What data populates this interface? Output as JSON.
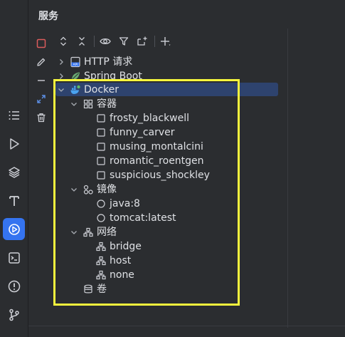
{
  "panel": {
    "title": "服务"
  },
  "tree": {
    "http": "HTTP 请求",
    "spring": "Spring Boot",
    "docker": "Docker",
    "containers": {
      "label": "容器",
      "items": [
        "frosty_blackwell",
        "funny_carver",
        "musing_montalcini",
        "romantic_roentgen",
        "suspicious_shockley"
      ]
    },
    "images": {
      "label": "镜像",
      "items": [
        "java:8",
        "tomcat:latest"
      ]
    },
    "networks": {
      "label": "网络",
      "items": [
        "bridge",
        "host",
        "none"
      ]
    },
    "volumes": {
      "label": "卷"
    }
  },
  "colors": {
    "background": "#2b2d30",
    "selection": "#2e436e",
    "highlight": "#f5f53d",
    "active_tool": "#3574f0",
    "docker_blue": "#4aa3f0"
  }
}
